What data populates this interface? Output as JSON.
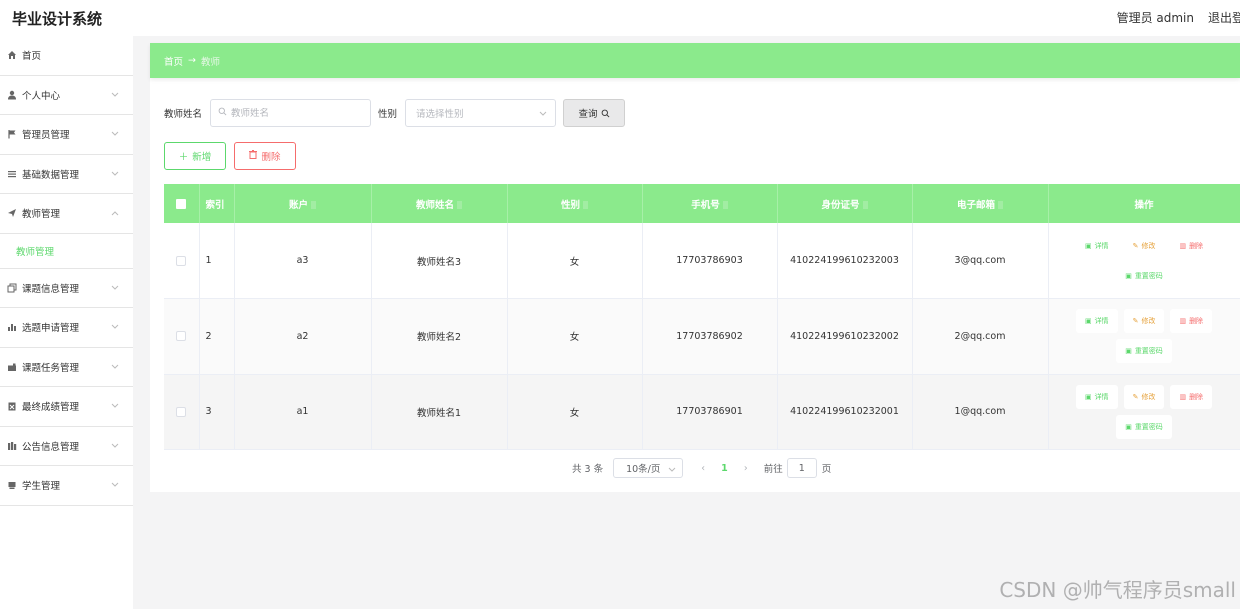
{
  "app": {
    "title": "毕业设计系统"
  },
  "header": {
    "admin_label": "管理员 admin",
    "logout_label": "退出登录"
  },
  "sidebar": {
    "items": [
      {
        "label": "首页",
        "icon": "home-icon",
        "has_arrow": false
      },
      {
        "label": "个人中心",
        "icon": "user-icon",
        "has_arrow": true
      },
      {
        "label": "管理员管理",
        "icon": "flag-icon",
        "has_arrow": true
      },
      {
        "label": "基础数据管理",
        "icon": "list-icon",
        "has_arrow": true
      },
      {
        "label": "教师管理",
        "icon": "send-icon",
        "has_arrow": true,
        "expanded": true
      },
      {
        "label": "课题信息管理",
        "icon": "copy-icon",
        "has_arrow": true
      },
      {
        "label": "选题申请管理",
        "icon": "bar-chart-icon",
        "has_arrow": true
      },
      {
        "label": "课题任务管理",
        "icon": "briefcase-icon",
        "has_arrow": true
      },
      {
        "label": "最终成绩管理",
        "icon": "clipboard-icon",
        "has_arrow": true
      },
      {
        "label": "公告信息管理",
        "icon": "building-icon",
        "has_arrow": true
      },
      {
        "label": "学生管理",
        "icon": "folder-icon",
        "has_arrow": true
      }
    ],
    "sub_item": "教师管理"
  },
  "breadcrumb": {
    "home": "首页",
    "arrow": "→",
    "current": "教师"
  },
  "search": {
    "name_label": "教师姓名",
    "name_placeholder": "教师姓名",
    "gender_label": "性别",
    "gender_placeholder": "请选择性别",
    "query_label": "查询"
  },
  "actions": {
    "add_label": "新增",
    "delete_label": "删除"
  },
  "table": {
    "columns": [
      "索引",
      "账户",
      "教师姓名",
      "性别",
      "手机号",
      "身份证号",
      "电子邮箱",
      "操作"
    ],
    "rows": [
      {
        "index": "1",
        "account": "a3",
        "name": "教师姓名3",
        "gender": "女",
        "phone": "17703786903",
        "id_card": "410224199610232003",
        "email": "3@qq.com"
      },
      {
        "index": "2",
        "account": "a2",
        "name": "教师姓名2",
        "gender": "女",
        "phone": "17703786902",
        "id_card": "410224199610232002",
        "email": "2@qq.com"
      },
      {
        "index": "3",
        "account": "a1",
        "name": "教师姓名1",
        "gender": "女",
        "phone": "17703786901",
        "id_card": "410224199610232001",
        "email": "1@qq.com"
      }
    ],
    "ops": {
      "detail": "详情",
      "edit": "修改",
      "remove": "删除",
      "reset": "重置密码"
    }
  },
  "pagination": {
    "total": "共 3 条",
    "page_size": "10条/页",
    "current": "1",
    "goto_label": "前往",
    "goto_value": "1",
    "page_suffix": "页"
  },
  "watermark": "CSDN @帅气程序员small",
  "colors": {
    "accent": "#8bea8c",
    "accent_text": "#5cd86c",
    "danger": "#f56c6c",
    "warning": "#e6a23c"
  }
}
